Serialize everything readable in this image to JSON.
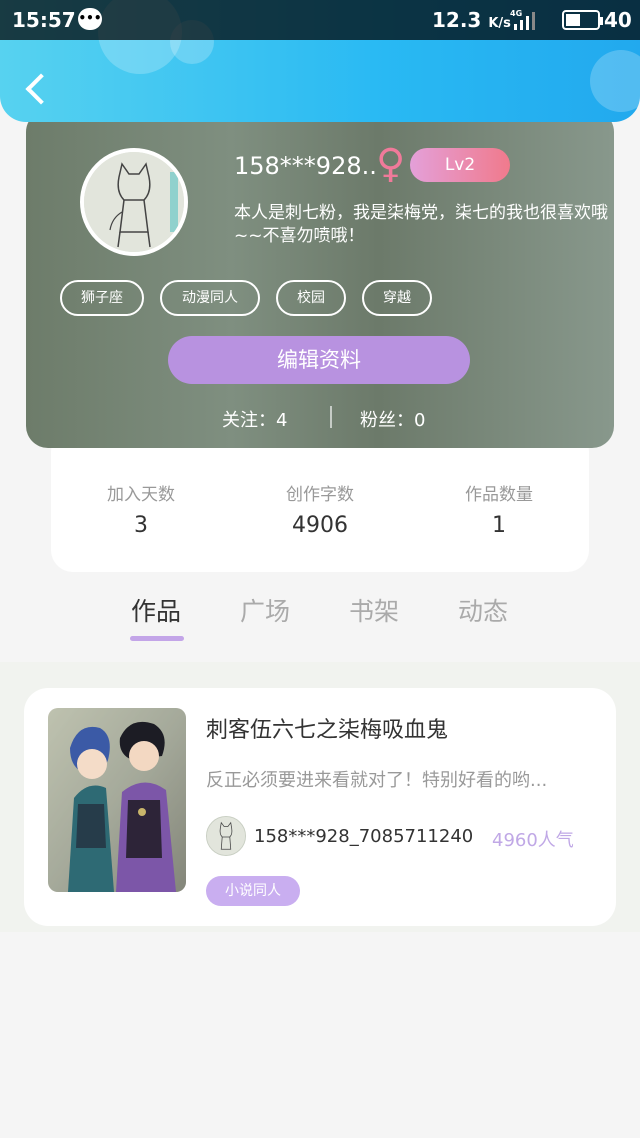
{
  "status_bar": {
    "time": "15:57",
    "message_icon": "message-bubble-icon",
    "speed": "12.3",
    "speed_unit": "K/s",
    "network": "4G",
    "battery": "40"
  },
  "header": {
    "back_icon": "chevron-left-icon",
    "bg_color": "#29b9f3"
  },
  "profile": {
    "username": "158***928..",
    "gender_icon": "female-symbol-icon",
    "gender_symbol": "♀",
    "level": "Lv2",
    "bio": "本人是刺七粉，我是柒梅党，柒七的我也很喜欢哦~~不喜勿喷哦！",
    "tags": [
      "狮子座",
      "动漫同人",
      "校园",
      "穿越"
    ],
    "edit_button": "编辑资料",
    "following_label": "关注：4",
    "followers_label": "粉丝：0"
  },
  "stats": [
    {
      "label": "加入天数",
      "value": "3"
    },
    {
      "label": "创作字数",
      "value": "4906"
    },
    {
      "label": "作品数量",
      "value": "1"
    }
  ],
  "tabs": [
    {
      "label": "作品",
      "active": true
    },
    {
      "label": "广场",
      "active": false
    },
    {
      "label": "书架",
      "active": false
    },
    {
      "label": "动态",
      "active": false
    }
  ],
  "works": [
    {
      "title": "刺客伍六七之柒梅吸血鬼",
      "description": "反正必须要进来看就对了！特别好看的哟...",
      "author": "158***928_7085711240",
      "popularity": "4960人气",
      "category": "小说同人"
    }
  ],
  "colors": {
    "accent_purple": "#b892e0",
    "popularity_purple": "#c0a8e6",
    "gender_pink": "#f07a9a"
  }
}
